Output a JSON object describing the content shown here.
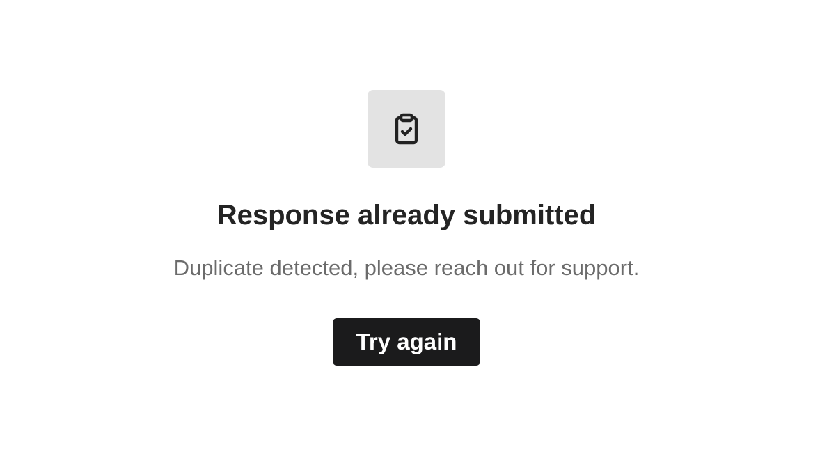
{
  "status_panel": {
    "icon": "clipboard-check-icon",
    "title": "Response already submitted",
    "message": "Duplicate detected, please reach out for support.",
    "button_label": "Try again"
  },
  "colors": {
    "background": "#ffffff",
    "icon_tile": "#e3e3e3",
    "title": "#242424",
    "message": "#6b6b6b",
    "button_background": "#1b1b1c",
    "button_text": "#ffffff"
  }
}
